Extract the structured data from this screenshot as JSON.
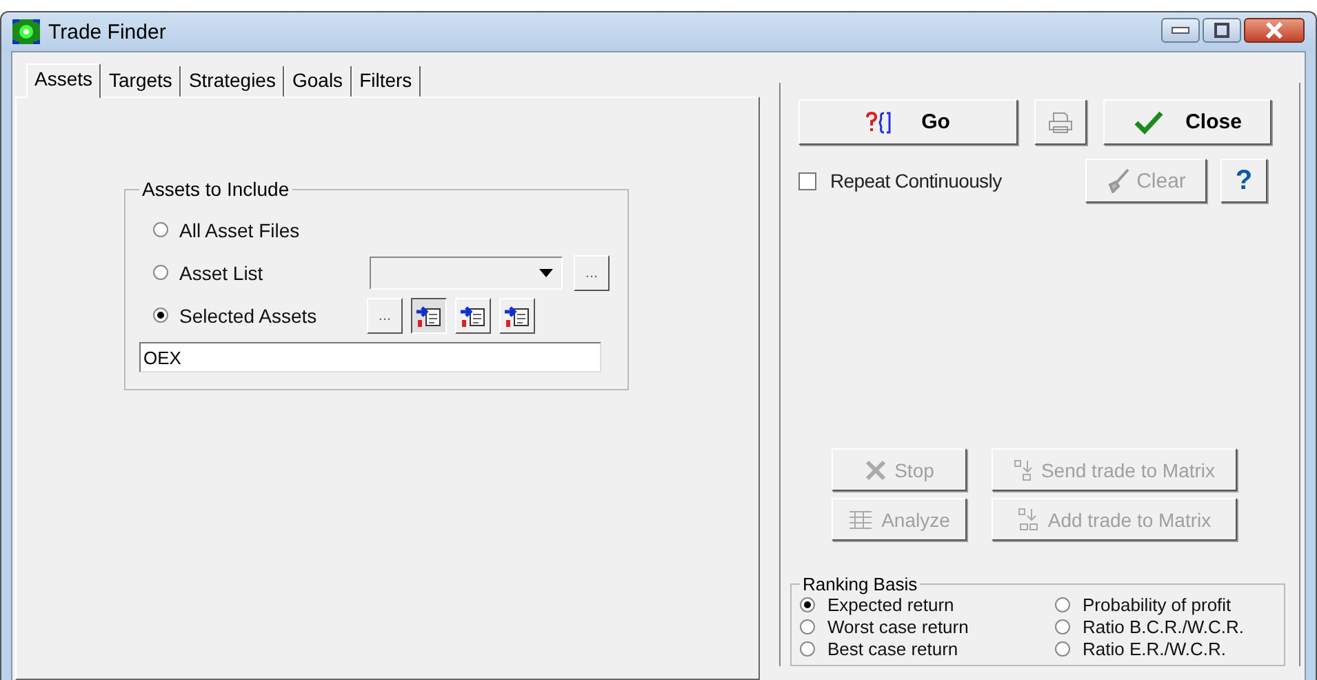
{
  "window": {
    "title": "Trade Finder"
  },
  "tabs": [
    {
      "label": "Assets",
      "selected": true
    },
    {
      "label": "Targets",
      "selected": false
    },
    {
      "label": "Strategies",
      "selected": false
    },
    {
      "label": "Goals",
      "selected": false
    },
    {
      "label": "Filters",
      "selected": false
    }
  ],
  "assets_group": {
    "title": "Assets to Include",
    "options": [
      {
        "label": "All Asset Files",
        "selected": false,
        "kind": "plain"
      },
      {
        "label": "Asset List",
        "selected": false,
        "kind": "list"
      },
      {
        "label": "Selected Assets",
        "selected": true,
        "kind": "selected"
      }
    ],
    "browse_button": "...",
    "selected_browse_button": "...",
    "tool_buttons": [
      {
        "pressed": true
      },
      {
        "pressed": false
      },
      {
        "pressed": false
      }
    ],
    "assets_value": "OEX"
  },
  "actions": {
    "go": {
      "label": "Go",
      "disabled": false
    },
    "print": {
      "disabled": true
    },
    "close": {
      "label": "Close",
      "disabled": false
    },
    "repeat": {
      "label": "Repeat Continuously",
      "checked": false
    },
    "clear": {
      "label": "Clear",
      "disabled": true
    },
    "help": {
      "label": "?",
      "disabled": false
    },
    "stop": {
      "label": "Stop",
      "disabled": true
    },
    "send": {
      "label": "Send trade to Matrix",
      "disabled": true
    },
    "analyze": {
      "label": "Analyze",
      "disabled": true
    },
    "add": {
      "label": "Add trade to Matrix",
      "disabled": true
    }
  },
  "ranking": {
    "title": "Ranking Basis",
    "options": [
      {
        "label": "Expected return",
        "selected": true
      },
      {
        "label": "Probability of profit",
        "selected": false
      },
      {
        "label": "Worst case return",
        "selected": false
      },
      {
        "label": "Ratio B.C.R./W.C.R.",
        "selected": false
      },
      {
        "label": "Best case return",
        "selected": false
      },
      {
        "label": "Ratio E.R./W.C.R.",
        "selected": false
      }
    ]
  }
}
